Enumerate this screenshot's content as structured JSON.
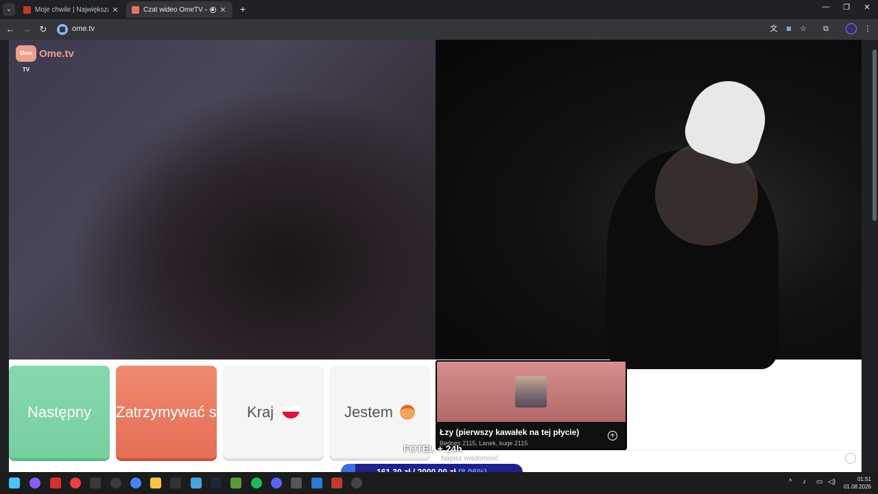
{
  "browser": {
    "tabs": [
      {
        "title": "Moje chwile | Największa stron",
        "favicon_color": "#c0392b",
        "active": false
      },
      {
        "title": "Czat wideo OmeTV — alter",
        "favicon_color": "#e8736a",
        "active": true
      }
    ],
    "url": "ome.tv",
    "tab_menu_icon": "chevron-down-icon",
    "new_tab_glyph": "+",
    "close_glyph": "✕"
  },
  "site": {
    "logo_badge": "Ome TV",
    "logo_text": "Ome.tv"
  },
  "controls": {
    "next_label": "Następny",
    "stop_label": "Zatrzymywać się",
    "country_label": "Kraj",
    "gender_label": "Jestem"
  },
  "chat": {
    "placeholder": "Napisz wiadomość"
  },
  "now_playing": {
    "title": "Łzy (pierwszy kawałek na tej płycie)",
    "artists": "Bedoes 2115, Lanek, kuqe 2115"
  },
  "overlay": {
    "fotel_text": "FOTEL + 24h"
  },
  "donation_goal": {
    "current": "161,30 zł",
    "separator": "/",
    "target": "2000,00 zł",
    "percent_text": "(8.06%)",
    "progress": 0.0806
  },
  "taskbar": {
    "time": "01:51",
    "date": "01.08.2026"
  }
}
